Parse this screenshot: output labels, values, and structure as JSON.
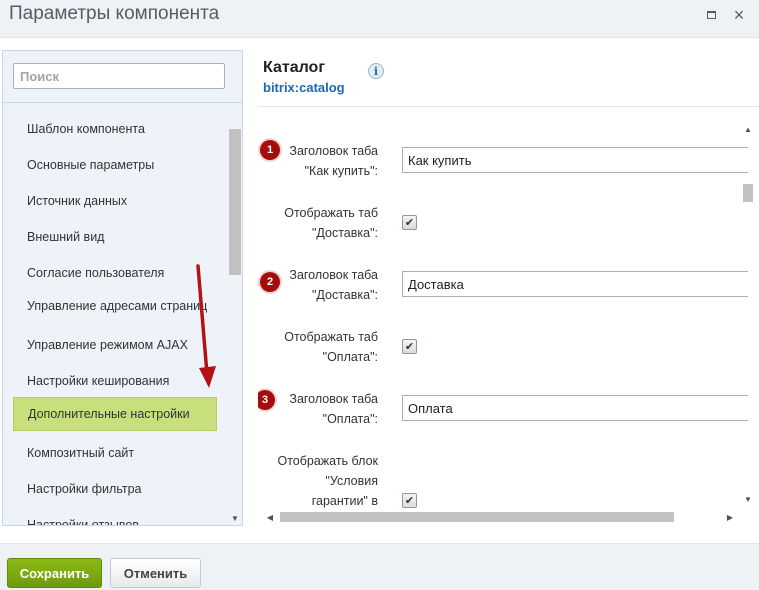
{
  "window": {
    "title": "Параметры компонента",
    "icons": {
      "maximize": "maximize-icon",
      "close": "close-icon"
    },
    "close_glyph": "×"
  },
  "sidebar": {
    "search": {
      "placeholder": "Поиск",
      "value": ""
    },
    "items": [
      {
        "label": "Шаблон компонента",
        "active": false
      },
      {
        "label": "Основные параметры",
        "active": false
      },
      {
        "label": "Источник данных",
        "active": false
      },
      {
        "label": "Внешний вид",
        "active": false
      },
      {
        "label": "Согласие пользователя",
        "active": false
      },
      {
        "label": "Управление адресами страниц",
        "active": false
      },
      {
        "label": "Управление режимом AJAX",
        "active": false
      },
      {
        "label": "Настройки кеширования",
        "active": false
      },
      {
        "label": "Дополнительные настройки",
        "active": true
      },
      {
        "label": "Композитный сайт",
        "active": false
      },
      {
        "label": "Настройки фильтра",
        "active": false
      },
      {
        "label": "Настройки отзывов",
        "active": false
      }
    ]
  },
  "component": {
    "name": "Каталог",
    "code": "bitrix:catalog",
    "info_glyph": "i"
  },
  "form": {
    "rows": [
      {
        "badge": "1",
        "label_line1": "Заголовок таба",
        "label_line2": "\"Как купить\":",
        "value": "Как купить"
      },
      {
        "label_line1": "Отображать таб",
        "label_line2": "\"Доставка\":",
        "checked": true
      },
      {
        "badge": "2",
        "label_line1": "Заголовок таба",
        "label_line2": "\"Доставка\":",
        "value": "Доставка"
      },
      {
        "label_line1": "Отображать таб",
        "label_line2": "\"Оплата\":",
        "checked": true
      },
      {
        "badge": "3",
        "label_line1": "Заголовок таба",
        "label_line2": "\"Оплата\":",
        "value": "Оплата"
      },
      {
        "label_line1": "Отображать блок",
        "label_line2": "\"Условия",
        "label_line3": "гарантии\" в",
        "checked": true
      }
    ],
    "check_glyph": "✔"
  },
  "annotation": {
    "arrow_color": "#b31212"
  },
  "colors": {
    "badge": "#a50d0d",
    "active_item": "#c8e07c",
    "save_button": "#7aaa10",
    "link": "#2067b0"
  },
  "footer": {
    "save_label": "Сохранить",
    "cancel_label": "Отменить"
  }
}
